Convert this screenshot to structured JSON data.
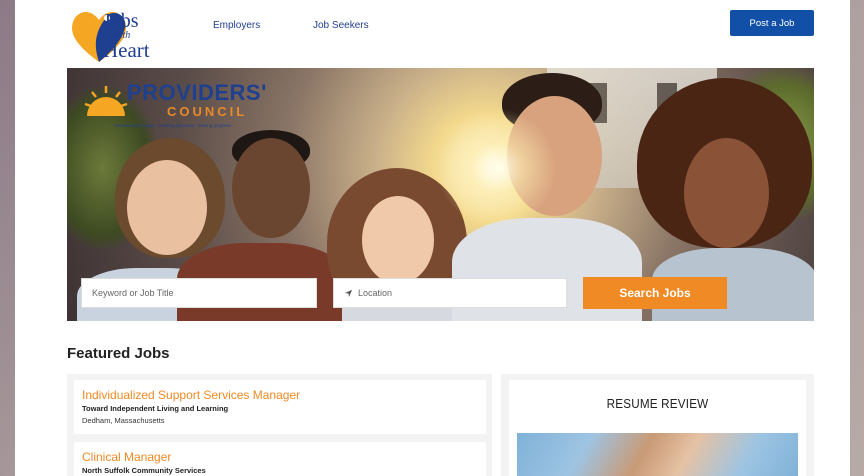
{
  "header": {
    "logo_line1": "Jobs",
    "logo_line2": "with",
    "logo_line3": "Heart",
    "nav": [
      "Employers",
      "Job Seekers"
    ],
    "post_button": "Post a Job"
  },
  "hero": {
    "brand_word1": "PROVIDERS'",
    "brand_word2": "COUNCIL",
    "brand_tagline": "Envisioning change · Leading advocacy · Driving progress",
    "keyword_placeholder": "Keyword or Job Title",
    "location_placeholder": "Location",
    "search_button": "Search Jobs"
  },
  "featured": {
    "title": "Featured Jobs",
    "jobs": [
      {
        "title": "Individualized Support Services Manager",
        "company": "Toward Independent Living and Learning",
        "location": "Dedham, Massachusetts"
      },
      {
        "title": "Clinical Manager",
        "company": "North Suffolk Community Services",
        "location": ""
      }
    ]
  },
  "sidebar": {
    "resume_title": "RESUME REVIEW"
  },
  "colors": {
    "accent_orange": "#f08a24",
    "brand_blue": "#1250a8",
    "nav_blue": "#1f3f8f"
  },
  "icons": {
    "location": "location-arrow-icon"
  }
}
